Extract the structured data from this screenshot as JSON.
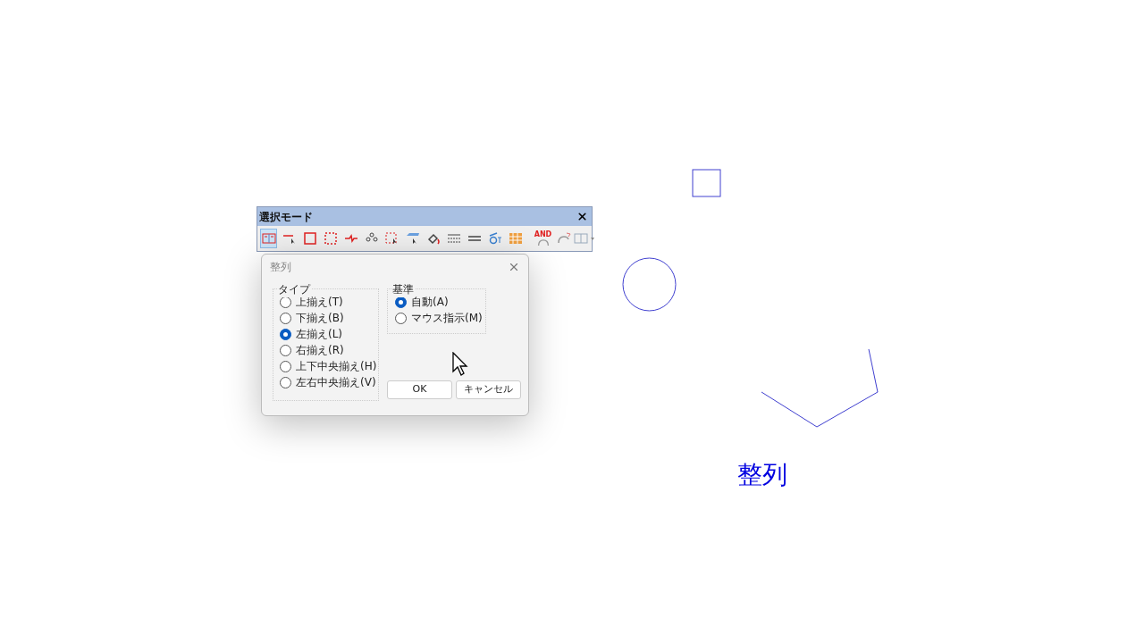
{
  "toolbar": {
    "title": "選択モード",
    "tools": [
      {
        "selected": true
      },
      {
        "selected": false
      },
      {
        "selected": false
      },
      {
        "selected": false
      },
      {
        "selected": false
      },
      {
        "selected": false
      },
      {
        "selected": false
      },
      {
        "selected": false
      },
      {
        "selected": false
      },
      {
        "selected": false
      },
      {
        "selected": false
      },
      {
        "selected": false
      },
      {
        "selected": false
      },
      {
        "selected": false,
        "label": "AND"
      },
      {
        "selected": false
      },
      {
        "selected": false
      }
    ]
  },
  "dialog": {
    "title": "整列",
    "type_group": {
      "title": "タイプ",
      "options": [
        {
          "label": "上揃え(T)",
          "selected": false
        },
        {
          "label": "下揃え(B)",
          "selected": false
        },
        {
          "label": "左揃え(L)",
          "selected": true
        },
        {
          "label": "右揃え(R)",
          "selected": false
        },
        {
          "label": "上下中央揃え(H)",
          "selected": false
        },
        {
          "label": "左右中央揃え(V)",
          "selected": false
        }
      ]
    },
    "basis_group": {
      "title": "基準",
      "options": [
        {
          "label": "自動(A)",
          "selected": true
        },
        {
          "label": "マウス指示(M)",
          "selected": false
        }
      ]
    },
    "buttons": [
      "OK",
      "キャンセル"
    ]
  },
  "canvas": {
    "text": "整列"
  }
}
